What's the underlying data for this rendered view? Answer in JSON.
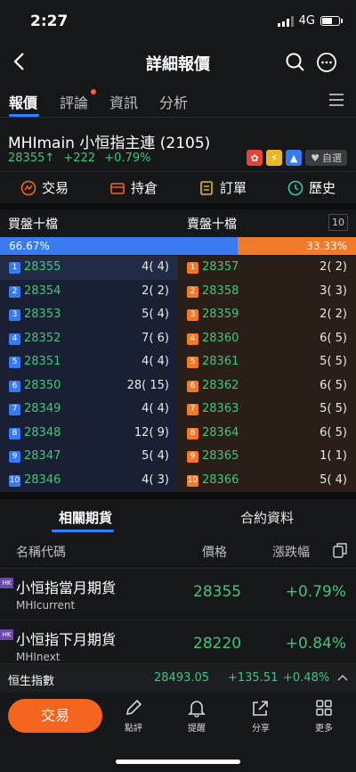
{
  "status": {
    "time": "2:27",
    "network": "4G"
  },
  "nav": {
    "title": "詳細報價"
  },
  "tabs": [
    {
      "label": "報價"
    },
    {
      "label": "評論"
    },
    {
      "label": "資訊"
    },
    {
      "label": "分析"
    }
  ],
  "instrument": {
    "name": "MHImain  小恒指主連 (2105)",
    "price": "28355",
    "change": "+222",
    "change_pct": "+0.79%",
    "watch_label": "自選"
  },
  "actions": [
    {
      "label": "交易",
      "icon": "trade-icon"
    },
    {
      "label": "持倉",
      "icon": "position-icon"
    },
    {
      "label": "訂單",
      "icon": "order-icon"
    },
    {
      "label": "歷史",
      "icon": "history-icon"
    }
  ],
  "orderbook": {
    "bid_title": "買盤十檔",
    "ask_title": "賣盤十檔",
    "depth": "10",
    "bid_pct": "66.67%",
    "ask_pct": "33.33%",
    "bids": [
      {
        "idx": "1",
        "price": "28355",
        "vol": "4(    4)"
      },
      {
        "idx": "2",
        "price": "28354",
        "vol": "2(    2)"
      },
      {
        "idx": "3",
        "price": "28353",
        "vol": "5(    4)"
      },
      {
        "idx": "4",
        "price": "28352",
        "vol": "7(    6)"
      },
      {
        "idx": "5",
        "price": "28351",
        "vol": "4(    4)"
      },
      {
        "idx": "6",
        "price": "28350",
        "vol": "28(   15)"
      },
      {
        "idx": "7",
        "price": "28349",
        "vol": "4(    4)"
      },
      {
        "idx": "8",
        "price": "28348",
        "vol": "12(    9)"
      },
      {
        "idx": "9",
        "price": "28347",
        "vol": "5(    4)"
      },
      {
        "idx": "10",
        "price": "28346",
        "vol": "4(    3)"
      }
    ],
    "asks": [
      {
        "idx": "1",
        "price": "28357",
        "vol": "2(    2)"
      },
      {
        "idx": "2",
        "price": "28358",
        "vol": "3(    3)"
      },
      {
        "idx": "3",
        "price": "28359",
        "vol": "2(    2)"
      },
      {
        "idx": "4",
        "price": "28360",
        "vol": "6(    5)"
      },
      {
        "idx": "5",
        "price": "28361",
        "vol": "5(    5)"
      },
      {
        "idx": "6",
        "price": "28362",
        "vol": "6(    5)"
      },
      {
        "idx": "7",
        "price": "28363",
        "vol": "5(    5)"
      },
      {
        "idx": "8",
        "price": "28364",
        "vol": "6(    5)"
      },
      {
        "idx": "9",
        "price": "28365",
        "vol": "1(    1)"
      },
      {
        "idx": "10",
        "price": "28366",
        "vol": "5(    4)"
      }
    ]
  },
  "futures": {
    "tab_related": "相關期貨",
    "tab_contract": "合約資料",
    "col_name": "名稱代碼",
    "col_price": "價格",
    "col_change": "漲跌幅",
    "hk_badge": "HK",
    "rows": [
      {
        "name": "小恒指當月期貨",
        "code": "MHIcurrent",
        "price": "28355",
        "change": "+0.79%"
      },
      {
        "name": "小恒指下月期貨",
        "code": "MHInext",
        "price": "28220",
        "change": "+0.84%"
      }
    ]
  },
  "index": {
    "name": "恒生指數",
    "value": "28493.05",
    "change": "+135.51",
    "change_pct": "+0.48%"
  },
  "bottom": {
    "trade": "交易",
    "items": [
      {
        "label": "點評",
        "icon": "pen-icon"
      },
      {
        "label": "提醒",
        "icon": "bell-icon"
      },
      {
        "label": "分享",
        "icon": "share-icon"
      },
      {
        "label": "更多",
        "icon": "grid-icon"
      }
    ]
  },
  "colors": {
    "up": "#3ec77a",
    "bid": "#3a7af0",
    "ask": "#f07a2a",
    "accent": "#2f82ff",
    "trade_button": "#f5651f"
  }
}
